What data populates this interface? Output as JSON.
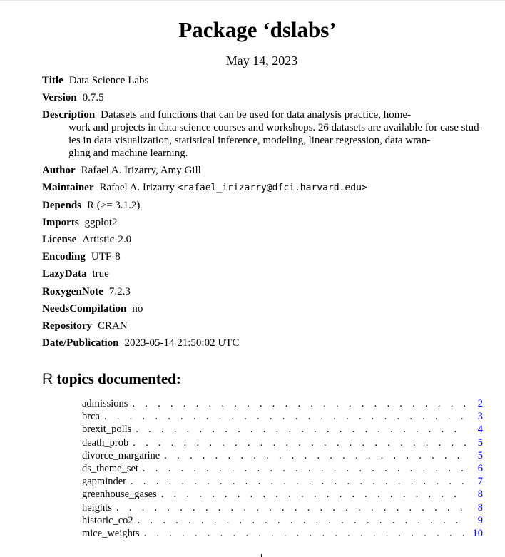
{
  "package_title": "Package ‘dslabs’",
  "date": "May 14, 2023",
  "fields": {
    "title": {
      "key": "Title",
      "value": "Data Science Labs"
    },
    "version": {
      "key": "Version",
      "value": "0.7.5"
    },
    "description": {
      "key": "Description",
      "lines": [
        "Datasets and functions that can be used for data analysis practice, home-",
        "work and projects in data science courses and workshops. 26 datasets are available for case stud-",
        "ies in data visualization, statistical inference, modeling, linear regression, data wran-",
        "gling and machine learning."
      ]
    },
    "author": {
      "key": "Author",
      "value": "Rafael A. Irizarry, Amy Gill"
    },
    "maintainer": {
      "key": "Maintainer",
      "value": "Rafael A. Irizarry",
      "email": "<rafael_irizarry@dfci.harvard.edu>"
    },
    "depends": {
      "key": "Depends",
      "value": "R (>= 3.1.2)"
    },
    "imports": {
      "key": "Imports",
      "value": "ggplot2"
    },
    "license": {
      "key": "License",
      "value": "Artistic-2.0"
    },
    "encoding": {
      "key": "Encoding",
      "value": "UTF-8"
    },
    "lazydata": {
      "key": "LazyData",
      "value": "true"
    },
    "roxygennote": {
      "key": "RoxygenNote",
      "value": "7.2.3"
    },
    "needscompilation": {
      "key": "NeedsCompilation",
      "value": "no"
    },
    "repository": {
      "key": "Repository",
      "value": "CRAN"
    },
    "datepublication": {
      "key": "Date/Publication",
      "value": "2023-05-14 21:50:02 UTC"
    }
  },
  "topics_heading": {
    "r": "R",
    "text": "topics documented:"
  },
  "toc": [
    {
      "name": "admissions",
      "page": "2"
    },
    {
      "name": "brca",
      "page": "3"
    },
    {
      "name": "brexit_polls",
      "page": "4"
    },
    {
      "name": "death_prob",
      "page": "5"
    },
    {
      "name": "divorce_margarine",
      "page": "5"
    },
    {
      "name": "ds_theme_set",
      "page": "6"
    },
    {
      "name": "gapminder",
      "page": "7"
    },
    {
      "name": "greenhouse_gases",
      "page": "8"
    },
    {
      "name": "heights",
      "page": "8"
    },
    {
      "name": "historic_co2",
      "page": "9"
    },
    {
      "name": "mice_weights",
      "page": "10"
    }
  ]
}
